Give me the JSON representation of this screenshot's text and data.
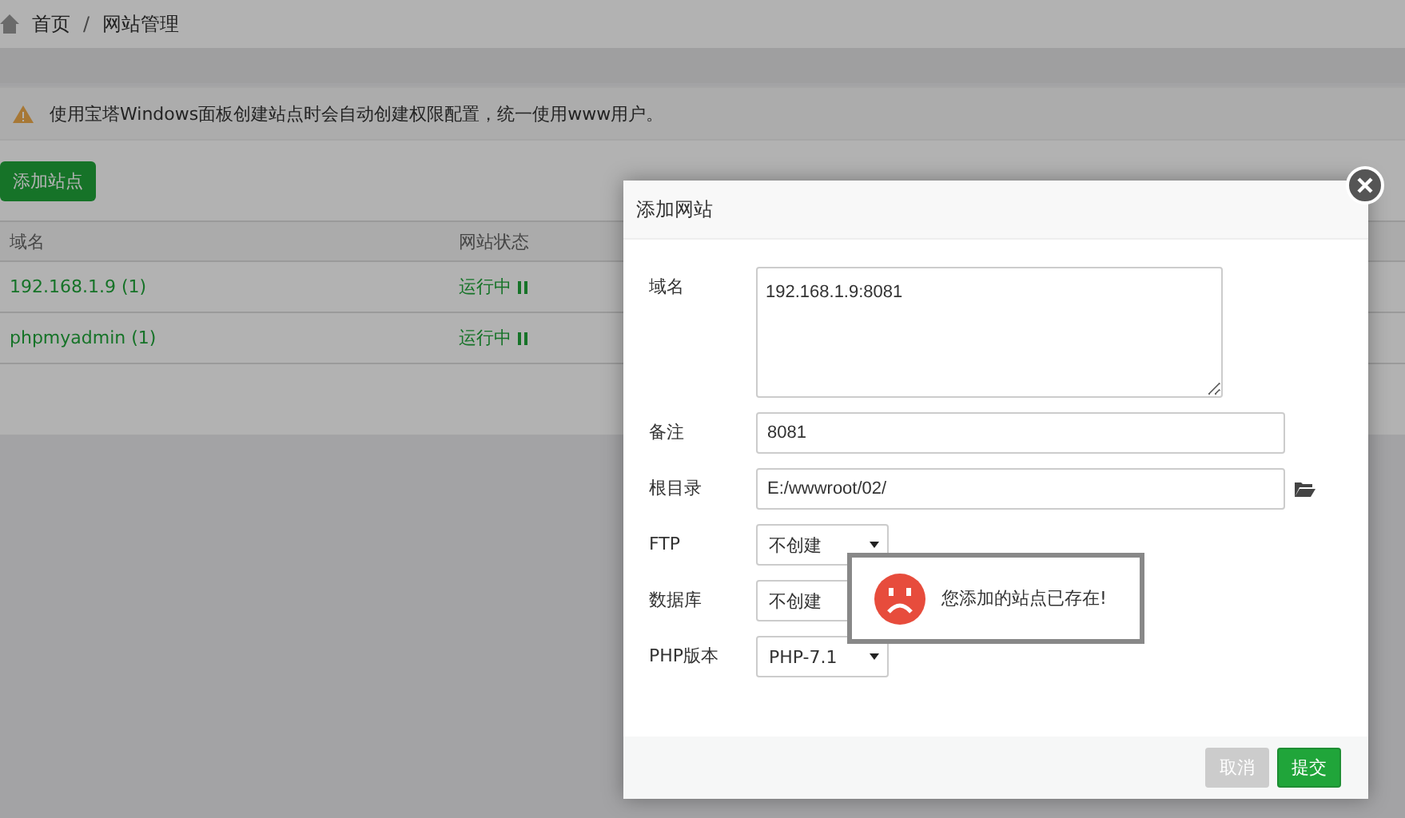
{
  "breadcrumb": [
    "首页",
    "网站管理"
  ],
  "breadcrumb_separator": "/",
  "alert": {
    "text": "使用宝塔Windows面板创建站点时会自动创建权限配置，统一使用www用户。"
  },
  "add_button": "添加站点",
  "table": {
    "columns": [
      "域名",
      "网站状态"
    ],
    "rows": [
      {
        "domain": "192.168.1.9 (1)",
        "status": "运行中",
        "running": true
      },
      {
        "domain": "phpmyadmin (1)",
        "status": "运行中",
        "running": true
      }
    ]
  },
  "dialog": {
    "title": "添加网站",
    "fields": [
      {
        "kind": "textarea",
        "label": "域名",
        "value": "192.168.1.9:8081"
      },
      {
        "kind": "input",
        "label": "备注",
        "value": "8081"
      },
      {
        "kind": "path",
        "label": "根目录",
        "value": "E:/wwwroot/02/"
      },
      {
        "kind": "select",
        "label": "FTP",
        "values": [
          "不创建"
        ]
      },
      {
        "kind": "select_pair",
        "label": "数据库",
        "values": [
          "不创建"
        ]
      },
      {
        "kind": "select",
        "label": "PHP版本",
        "values": [
          "PHP-7.1"
        ]
      }
    ],
    "buttons": [
      {
        "kind": "cancel",
        "label": "取消"
      },
      {
        "kind": "submit",
        "label": "提交"
      }
    ]
  },
  "toast": {
    "kind": "error",
    "message": "您添加的站点已存在!"
  }
}
